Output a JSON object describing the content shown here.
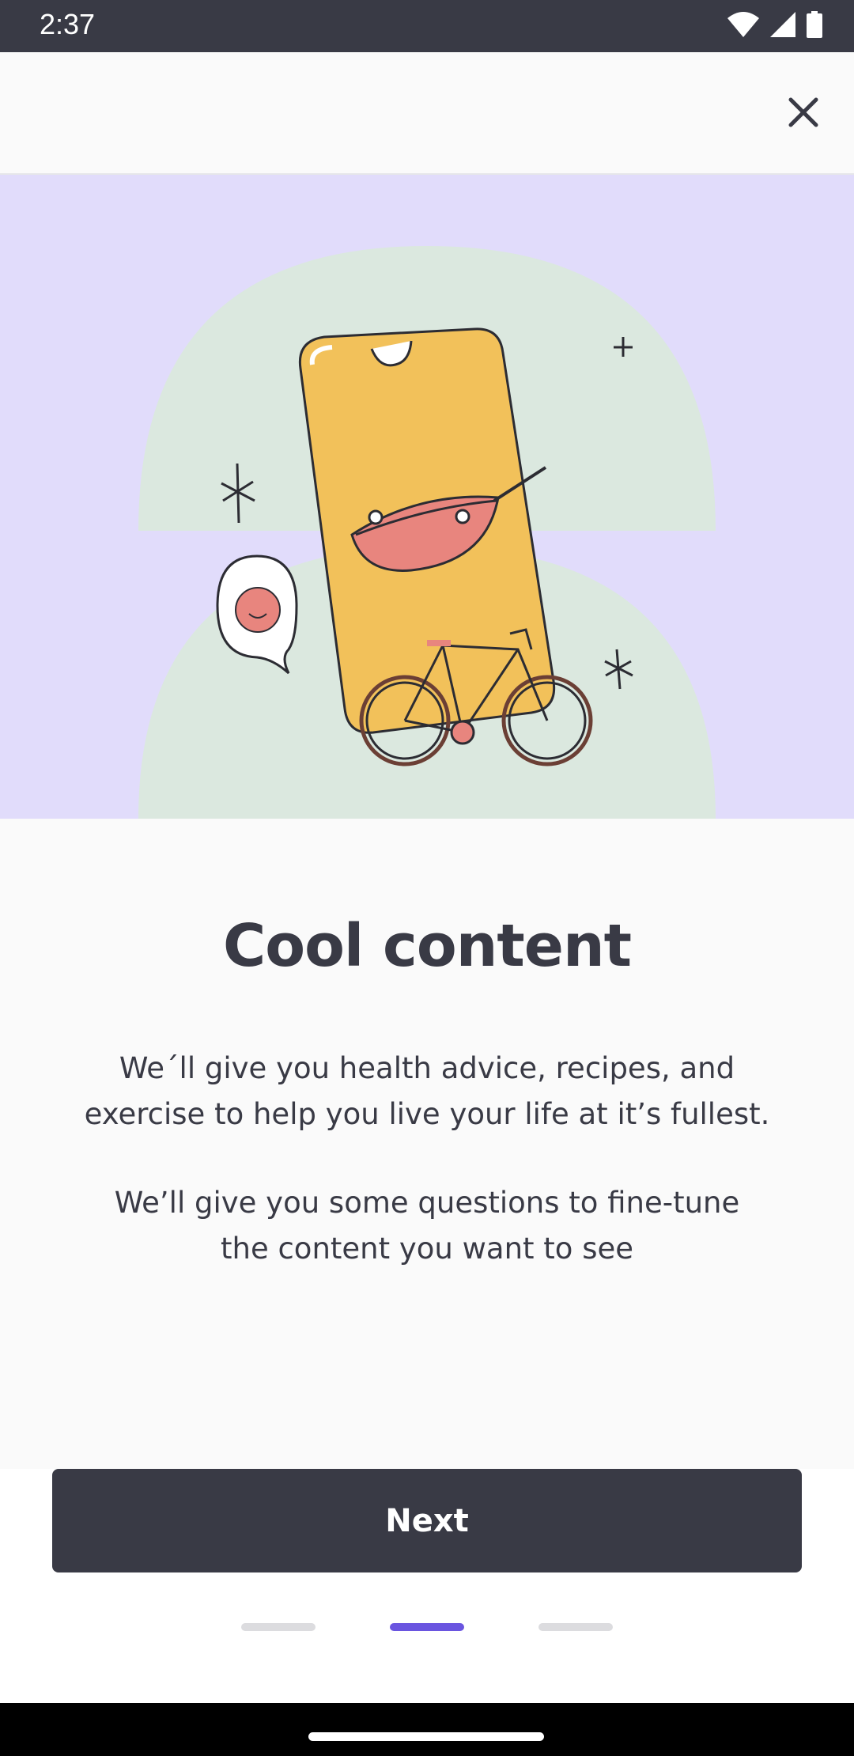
{
  "status_bar": {
    "time": "2:37",
    "icons": [
      "wifi-icon",
      "cellular-signal-icon",
      "battery-icon"
    ]
  },
  "header": {
    "close_icon": "close-icon"
  },
  "hero": {
    "illustration": "phone-with-wok-bicycle-and-egg",
    "colors": {
      "background": "#e1dcfb",
      "blob": "#dbe8df",
      "phone": "#f2c15a",
      "accent": "#e8857e"
    }
  },
  "content": {
    "title": "Cool content",
    "paragraph1": [
      "We´ll give you health advice, recipes, and",
      "exercise to help you live your life at it’s fullest."
    ],
    "paragraph2": [
      "We’ll give you some questions to fine-tune",
      "the content you want to see"
    ]
  },
  "actions": {
    "next_label": "Next"
  },
  "pager": {
    "count": 3,
    "active_index": 1
  },
  "theme": {
    "dark": "#393a45",
    "accent": "#6a55e0",
    "inactive_dot": "#dcdcdf"
  }
}
